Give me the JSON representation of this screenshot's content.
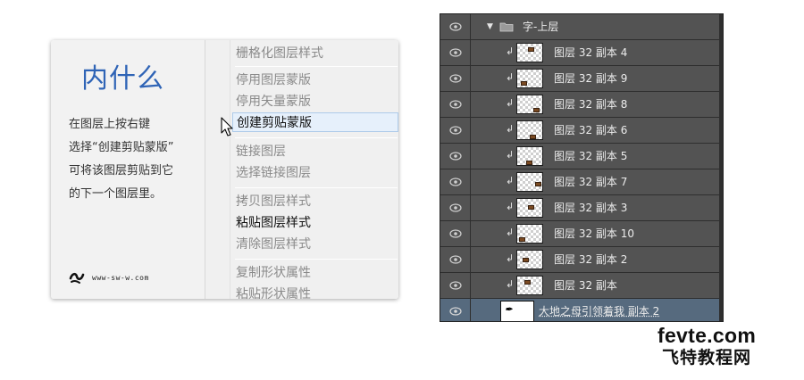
{
  "tutorial": {
    "title": "内什么",
    "description_lines": [
      "在图层上按右键",
      "选择“创建剪贴蒙版”",
      "可将该图层剪贴到它",
      "的下一个图层里。"
    ],
    "logo_text": "www-sw-w.com"
  },
  "context_menu": {
    "items": [
      {
        "label": "栅格化图层样式",
        "enabled": false
      },
      {
        "label": "停用图层蒙版",
        "enabled": false
      },
      {
        "label": "停用矢量蒙版",
        "enabled": false
      },
      {
        "label": "创建剪贴蒙版",
        "enabled": true,
        "selected": true
      },
      {
        "label": "链接图层",
        "enabled": false
      },
      {
        "label": "选择链接图层",
        "enabled": false
      },
      {
        "label": "拷贝图层样式",
        "enabled": false
      },
      {
        "label": "粘贴图层样式",
        "enabled": true
      },
      {
        "label": "清除图层样式",
        "enabled": false
      },
      {
        "label": "复制形状属性",
        "enabled": false
      },
      {
        "label": "粘贴形状属性",
        "enabled": false
      }
    ]
  },
  "layers_panel": {
    "group": {
      "name": "字-上层"
    },
    "layers": [
      {
        "name": "图层 32 副本 4"
      },
      {
        "name": "图层 32 副本 9"
      },
      {
        "name": "图层 32 副本 8"
      },
      {
        "name": "图层 32 副本 6"
      },
      {
        "name": "图层 32 副本 5"
      },
      {
        "name": "图层 32 副本 7"
      },
      {
        "name": "图层 32 副本 3"
      },
      {
        "name": "图层 32 副本 10"
      },
      {
        "name": "图层 32 副本 2"
      },
      {
        "name": "图层 32 副本"
      }
    ],
    "base_layer": {
      "name": "大地之母引领着我 副本 2"
    }
  },
  "watermark": {
    "site": "fevte.com",
    "name": "飞特教程网"
  },
  "colors": {
    "title_blue": "#2f64b6",
    "panel_bg": "#535353",
    "selected_layer": "#566a7e"
  }
}
